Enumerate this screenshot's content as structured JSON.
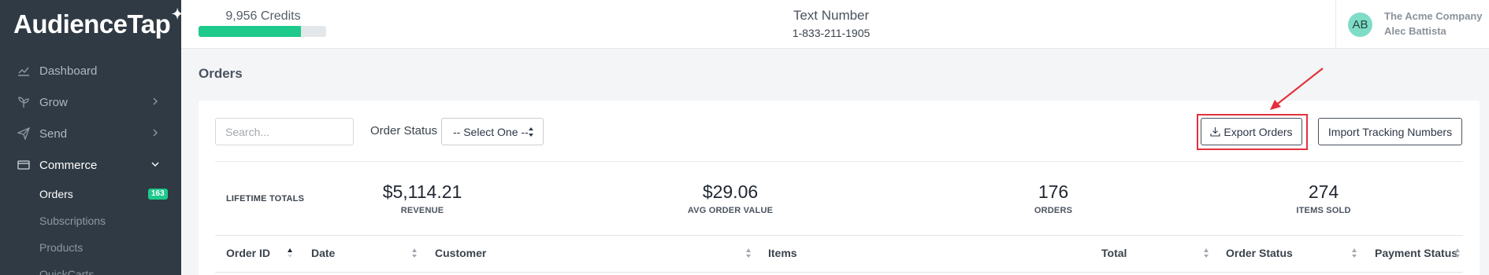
{
  "app": {
    "logo_text": "AudienceTap"
  },
  "sidebar": {
    "items": [
      {
        "label": "Dashboard",
        "icon": "chart-line-icon"
      },
      {
        "label": "Grow",
        "icon": "sprout-icon"
      },
      {
        "label": "Send",
        "icon": "paper-plane-icon"
      },
      {
        "label": "Commerce",
        "icon": "card-icon"
      }
    ],
    "sub_items": [
      {
        "label": "Orders",
        "badge": "163"
      },
      {
        "label": "Subscriptions"
      },
      {
        "label": "Products"
      },
      {
        "label": "QuickCarts"
      }
    ]
  },
  "header": {
    "credits_text": "9,956 Credits",
    "credits_fill": 0.8,
    "text_number_label": "Text Number",
    "text_number_value": "1-833-211-1905",
    "avatar_initials": "AB",
    "company": "The Acme Company",
    "user": "Alec Battista"
  },
  "main": {
    "title": "Orders",
    "search_placeholder": "Search...",
    "order_status_label": "Order Status",
    "order_status_value": "-- Select One --",
    "export_label": "Export Orders",
    "import_label": "Import Tracking Numbers",
    "lifetime_label": "LIFETIME TOTALS",
    "stats": [
      {
        "value": "$5,114.21",
        "label": "REVENUE"
      },
      {
        "value": "$29.06",
        "label": "AVG ORDER VALUE"
      },
      {
        "value": "176",
        "label": "ORDERS"
      },
      {
        "value": "274",
        "label": "ITEMS SOLD"
      }
    ],
    "columns": [
      "Order ID",
      "Date",
      "Customer",
      "Items",
      "Total",
      "Order Status",
      "Payment Status"
    ]
  },
  "colors": {
    "sidebar": "#2f3a44",
    "accent": "#1ec98c",
    "highlight": "#e3313d"
  }
}
